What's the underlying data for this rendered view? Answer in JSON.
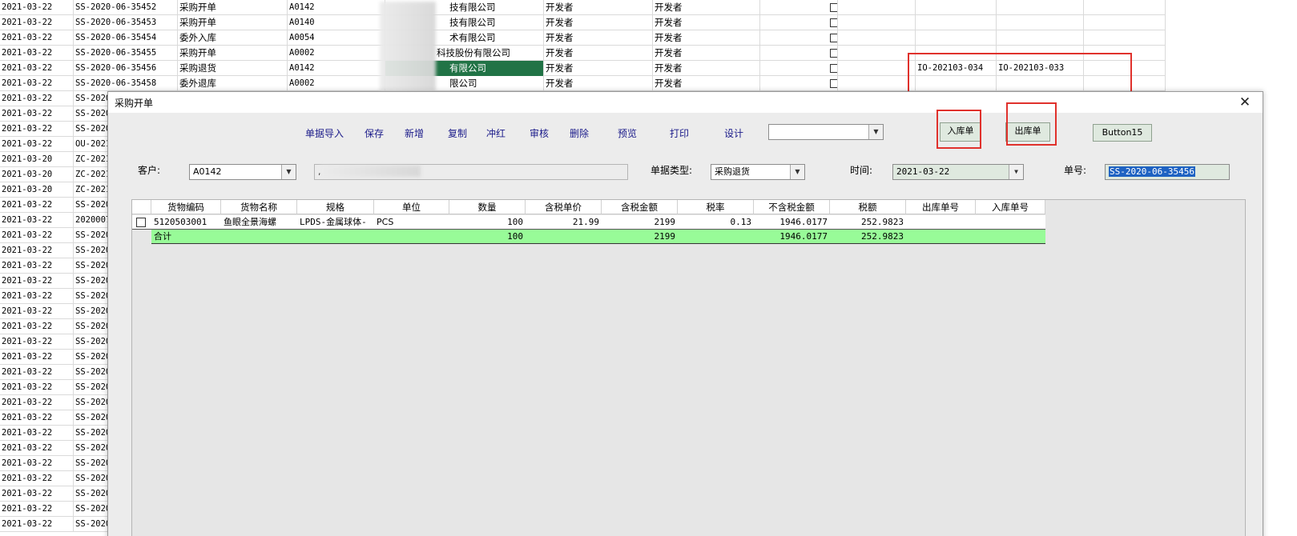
{
  "sheet": {
    "rows": [
      {
        "date": "2021-03-22",
        "no": "SS-2020-06-35452",
        "type": "采购开单",
        "code": "A0142",
        "company": "技有限公司",
        "user1": "开发者",
        "user2": "开发者"
      },
      {
        "date": "2021-03-22",
        "no": "SS-2020-06-35453",
        "type": "采购开单",
        "code": "A0140",
        "company": "技有限公司",
        "user1": "开发者",
        "user2": "开发者"
      },
      {
        "date": "2021-03-22",
        "no": "SS-2020-06-35454",
        "type": "委外入库",
        "code": "A0054",
        "company": "术有限公司",
        "user1": "开发者",
        "user2": "开发者"
      },
      {
        "date": "2021-03-22",
        "no": "SS-2020-06-35455",
        "type": "采购开单",
        "code": "A0002",
        "company": "科技股份有限公司",
        "user1": "开发者",
        "user2": "开发者"
      },
      {
        "date": "2021-03-22",
        "no": "SS-2020-06-35456",
        "type": "采购退货",
        "code": "A0142",
        "company": "有限公司",
        "user1": "开发者",
        "user2": "开发者",
        "in_no": "IO-202103-034",
        "out_no": "IO-202103-033"
      },
      {
        "date": "2021-03-22",
        "no": "SS-2020-06-35458",
        "type": "委外退库",
        "code": "A0002",
        "company": "限公司",
        "user1": "开发者",
        "user2": "开发者"
      },
      {
        "date": "2021-03-22",
        "no": "SS-2020"
      },
      {
        "date": "2021-03-22",
        "no": "SS-2020"
      },
      {
        "date": "2021-03-22",
        "no": "SS-2020"
      },
      {
        "date": "2021-03-22",
        "no": "OU-2021"
      },
      {
        "date": "2021-03-20",
        "no": "ZC-2021"
      },
      {
        "date": "2021-03-20",
        "no": "ZC-2021"
      },
      {
        "date": "2021-03-20",
        "no": "ZC-2021"
      },
      {
        "date": "2021-03-22",
        "no": "SS-2020"
      },
      {
        "date": "2021-03-22",
        "no": "2020007"
      },
      {
        "date": "2021-03-22",
        "no": "SS-2020"
      },
      {
        "date": "2021-03-22",
        "no": "SS-2020"
      },
      {
        "date": "2021-03-22",
        "no": "SS-2020"
      },
      {
        "date": "2021-03-22",
        "no": "SS-2020"
      },
      {
        "date": "2021-03-22",
        "no": "SS-2020"
      },
      {
        "date": "2021-03-22",
        "no": "SS-2020"
      },
      {
        "date": "2021-03-22",
        "no": "SS-2020"
      },
      {
        "date": "2021-03-22",
        "no": "SS-2020"
      },
      {
        "date": "2021-03-22",
        "no": "SS-2020"
      },
      {
        "date": "2021-03-22",
        "no": "SS-2020"
      },
      {
        "date": "2021-03-22",
        "no": "SS-2020"
      },
      {
        "date": "2021-03-22",
        "no": "SS-2020"
      },
      {
        "date": "2021-03-22",
        "no": "SS-2020"
      },
      {
        "date": "2021-03-22",
        "no": "SS-2020"
      },
      {
        "date": "2021-03-22",
        "no": "SS-2020"
      },
      {
        "date": "2021-03-22",
        "no": "SS-2020"
      },
      {
        "date": "2021-03-22",
        "no": "SS-2020"
      },
      {
        "date": "2021-03-22",
        "no": "SS-2020"
      },
      {
        "date": "2021-03-22",
        "no": "SS-2020"
      },
      {
        "date": "2021-03-22",
        "no": "SS-2020"
      }
    ],
    "selected_color": "#217346"
  },
  "dialog": {
    "title": "采购开单",
    "toolbar": [
      "单据导入",
      "保存",
      "新增",
      "复制",
      "冲红",
      "审核",
      "删除",
      "预览",
      "打印",
      "设计"
    ],
    "toolbar_combo_value": "",
    "in_button": "入库单",
    "out_button": "出库单",
    "button15": "Button15",
    "customer_label": "客户:",
    "customer_value": "A0142",
    "customer_name": ",",
    "doctype_label": "单据类型:",
    "doctype_value": "采购退货",
    "time_label": "时间:",
    "time_value": "2021-03-22",
    "docno_label": "单号:",
    "docno_value": "SS-2020-06-35456",
    "grid": {
      "headers": [
        "货物编码",
        "货物名称",
        "规格",
        "单位",
        "数量",
        "含税单价",
        "含税金额",
        "税率",
        "不含税金额",
        "税额",
        "出库单号",
        "入库单号"
      ],
      "row": [
        "5120503001",
        "鱼眼全景海螺",
        "LPDS-金属球体-",
        "PCS",
        "100",
        "21.99",
        "2199",
        "0.13",
        "1946.0177",
        "252.9823",
        "",
        ""
      ],
      "total": [
        "合计",
        "",
        "",
        "",
        "100",
        "",
        "2199",
        "",
        "1946.0177",
        "252.9823",
        "",
        ""
      ],
      "total_color": "#98fb98"
    }
  },
  "annotation_color": "#e0312c"
}
